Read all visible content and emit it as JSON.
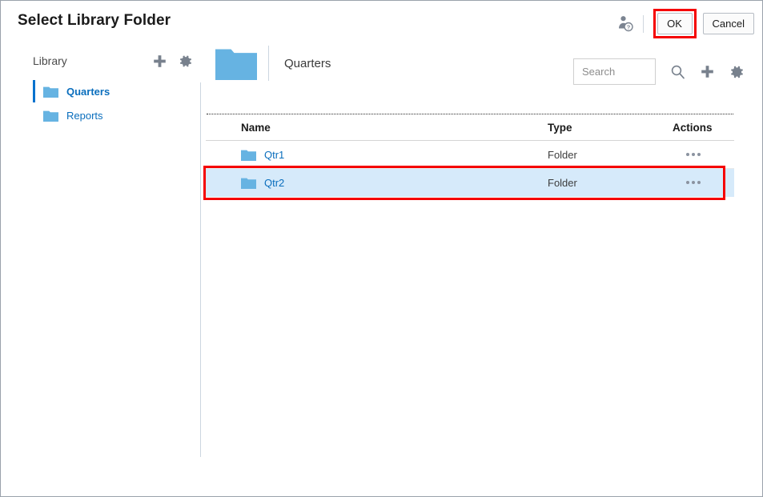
{
  "header": {
    "title": "Select Library Folder",
    "user_help_icon": "user-help-icon",
    "ok_label": "OK",
    "cancel_label": "Cancel",
    "highlight_color": "#f50000"
  },
  "sidebar": {
    "label": "Library",
    "add_icon": "plus-icon",
    "settings_icon": "gear-icon",
    "items": [
      {
        "label": "Quarters",
        "icon": "folder-icon",
        "selected": true
      },
      {
        "label": "Reports",
        "icon": "folder-icon",
        "selected": false
      }
    ]
  },
  "main": {
    "breadcrumb": {
      "icon": "folder-icon",
      "label": "Quarters"
    },
    "toolbar": {
      "search_value": "",
      "search_placeholder": "Search",
      "search_icon": "search-icon",
      "add_icon": "plus-icon",
      "settings_icon": "gear-icon"
    },
    "table": {
      "columns": [
        "Name",
        "Type",
        "Actions"
      ],
      "rows": [
        {
          "name": "Qtr1",
          "type": "Folder",
          "icon": "folder-icon",
          "actions_icon": "more-options-icon",
          "selected": false,
          "highlighted": false
        },
        {
          "name": "Qtr2",
          "type": "Folder",
          "icon": "folder-icon",
          "actions_icon": "more-options-icon",
          "selected": true,
          "highlighted": true
        }
      ]
    }
  },
  "colors": {
    "link": "#0a6ebd",
    "folder": "#66b3e2",
    "selected_row": "#d6eafa",
    "accent": "#0572ce",
    "annotation": "#f50000"
  }
}
